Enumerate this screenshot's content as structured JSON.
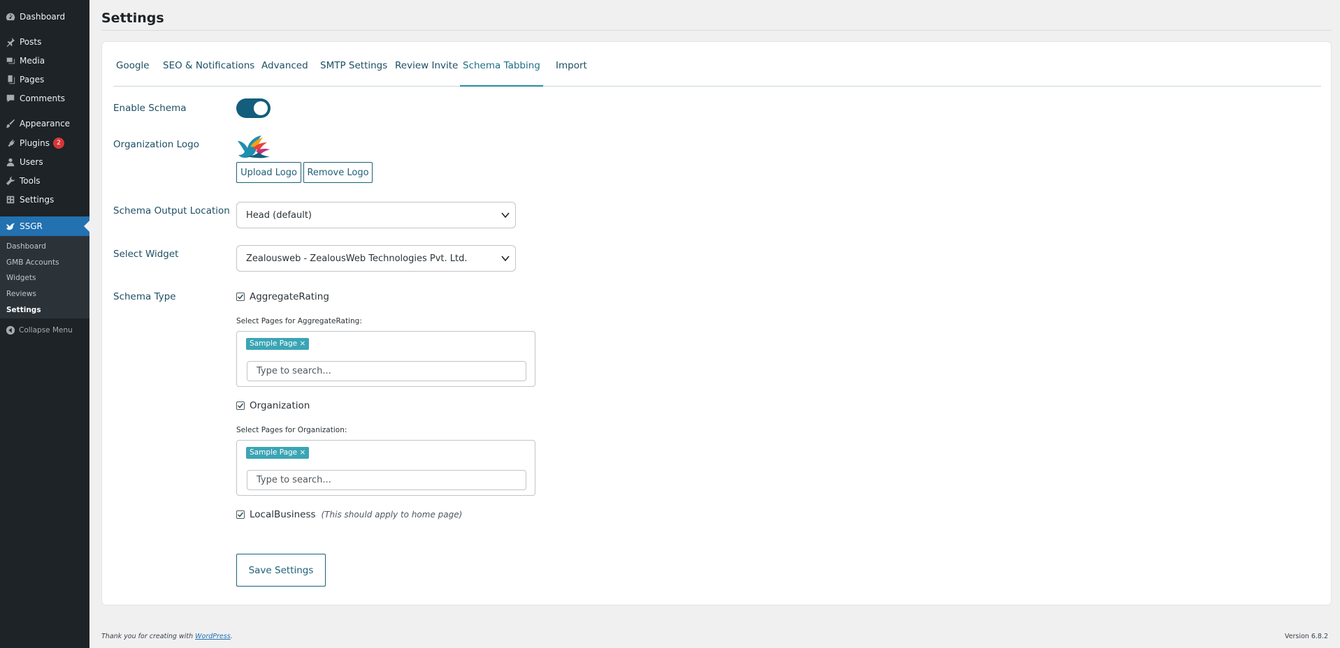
{
  "sidebar": {
    "items": [
      {
        "label": "Dashboard",
        "icon": "dashboard-icon"
      },
      {
        "label": "Posts",
        "icon": "pin-icon"
      },
      {
        "label": "Media",
        "icon": "media-icon"
      },
      {
        "label": "Pages",
        "icon": "pages-icon"
      },
      {
        "label": "Comments",
        "icon": "comment-icon"
      },
      {
        "label": "Appearance",
        "icon": "brush-icon"
      },
      {
        "label": "Plugins",
        "icon": "plug-icon",
        "badge": "2"
      },
      {
        "label": "Users",
        "icon": "user-icon"
      },
      {
        "label": "Tools",
        "icon": "wrench-icon"
      },
      {
        "label": "Settings",
        "icon": "settings-icon"
      },
      {
        "label": "SSGR",
        "icon": "bird-icon"
      }
    ],
    "submenu": [
      "Dashboard",
      "GMB Accounts",
      "Widgets",
      "Reviews",
      "Settings"
    ],
    "collapse_label": "Collapse Menu"
  },
  "page": {
    "title": "Settings"
  },
  "tabs": [
    "Google",
    "SEO & Notifications",
    "Advanced",
    "SMTP Settings",
    "Review Invite",
    "Schema Tabbing",
    "Import"
  ],
  "active_tab": "Schema Tabbing",
  "form": {
    "enable_schema_label": "Enable Schema",
    "enable_schema_on": true,
    "org_logo_label": "Organization Logo",
    "upload_logo": "Upload Logo",
    "remove_logo": "Remove Logo",
    "output_location_label": "Schema Output Location",
    "output_location_value": "Head (default)",
    "select_widget_label": "Select Widget",
    "select_widget_value": "Zealousweb - ZealousWeb Technologies Pvt. Ltd.",
    "schema_type_label": "Schema Type",
    "types": {
      "aggregate": {
        "label": "AggregateRating",
        "checked": true,
        "pages_label": "Select Pages for AggregateRating:",
        "chip": "Sample Page ×",
        "placeholder": "Type to search..."
      },
      "organization": {
        "label": "Organization",
        "checked": true,
        "pages_label": "Select Pages for Organization:",
        "chip": "Sample Page ×",
        "placeholder": "Type to search..."
      },
      "local": {
        "label": "LocalBusiness",
        "checked": true,
        "note": "(This should apply to home page)"
      }
    },
    "save_label": "Save Settings"
  },
  "footer": {
    "thanks_prefix": "Thank you for creating with ",
    "thanks_link": "WordPress",
    "thanks_suffix": ".",
    "version": "Version 6.8.2"
  },
  "colors": {
    "accent": "#135e7c",
    "sidebar": "#1d2327",
    "active_menu": "#2271b1",
    "chip": "#3ba5b5"
  }
}
